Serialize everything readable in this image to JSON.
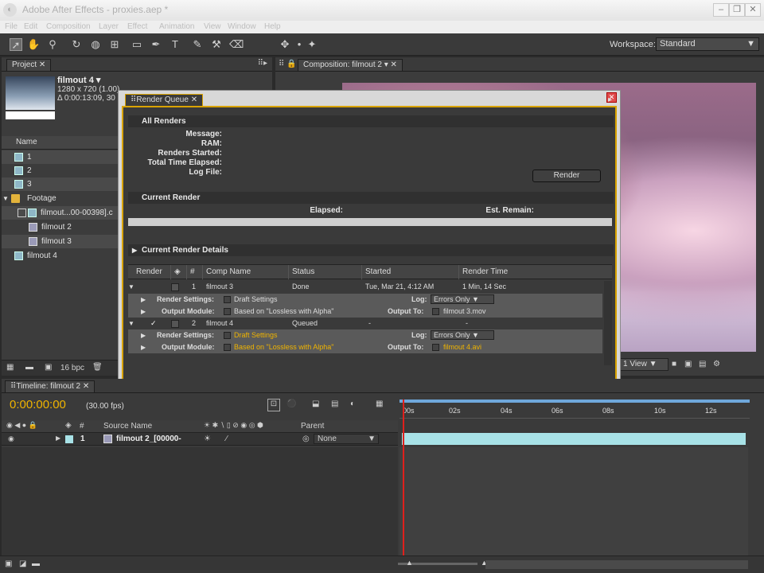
{
  "app": {
    "title": "Adobe After Effects - proxies.aep *"
  },
  "menu": [
    "File",
    "Edit",
    "Composition",
    "Layer",
    "Effect",
    "Animation",
    "View",
    "Window",
    "Help"
  ],
  "workspace": {
    "label": "Workspace:",
    "value": "Standard"
  },
  "project": {
    "tab": "Project",
    "item_name": "filmout 4 ▾",
    "item_res": "1280 x 720 (1.00)",
    "item_dur": "Δ 0:00:13:09, 30",
    "name_header": "Name",
    "items": [
      {
        "label": "1",
        "type": "comp"
      },
      {
        "label": "2",
        "type": "comp"
      },
      {
        "label": "3",
        "type": "comp"
      },
      {
        "label": "Footage",
        "type": "folder"
      },
      {
        "label": "filmout...00-00398].c",
        "type": "vid"
      },
      {
        "label": "filmout 2",
        "type": "vid"
      },
      {
        "label": "filmout 3",
        "type": "vid"
      },
      {
        "label": "filmout 4",
        "type": "comp"
      }
    ],
    "bpc": "16 bpc"
  },
  "composition": {
    "tab": "Composition: filmout 2",
    "view": "1 View"
  },
  "render_queue": {
    "tab": "Render Queue",
    "all_renders": "All Renders",
    "labels": {
      "message": "Message:",
      "ram": "RAM:",
      "renders_started": "Renders Started:",
      "total_time": "Total Time Elapsed:",
      "log_file": "Log File:"
    },
    "render_button": "Render",
    "current_render": "Current Render",
    "elapsed": "Elapsed:",
    "est_remain": "Est. Remain:",
    "details": "Current Render Details",
    "columns": [
      "Render",
      "#",
      "Comp Name",
      "Status",
      "Started",
      "Render Time"
    ],
    "rows": [
      {
        "num": "1",
        "name": "filmout 3",
        "status": "Done",
        "started": "Tue, Mar 21, 4:12 AM",
        "time": "1 Min, 14 Sec",
        "settings": "Draft Settings",
        "log": "Errors Only",
        "module": "Based on \"Lossless with Alpha\"",
        "output": "filmout 3.mov"
      },
      {
        "num": "2",
        "name": "filmout 4",
        "status": "Queued",
        "started": "-",
        "time": "-",
        "settings": "Draft Settings",
        "log": "Errors Only",
        "module": "Based on \"Lossless with Alpha\"",
        "output": "filmout 4.avi"
      }
    ],
    "render_settings_label": "Render Settings:",
    "output_module_label": "Output Module:",
    "log_label": "Log:",
    "output_to_label": "Output To:"
  },
  "timeline": {
    "tab": "Timeline: filmout 2",
    "timecode": "0:00:00:00",
    "fps": "(30.00 fps)",
    "col_num": "#",
    "col_source": "Source Name",
    "col_parent": "Parent",
    "layer": {
      "num": "1",
      "name": "filmout 2_[00000-",
      "parent": "None"
    },
    "ticks": [
      "00s",
      "02s",
      "04s",
      "06s",
      "08s",
      "10s",
      "12s"
    ]
  }
}
